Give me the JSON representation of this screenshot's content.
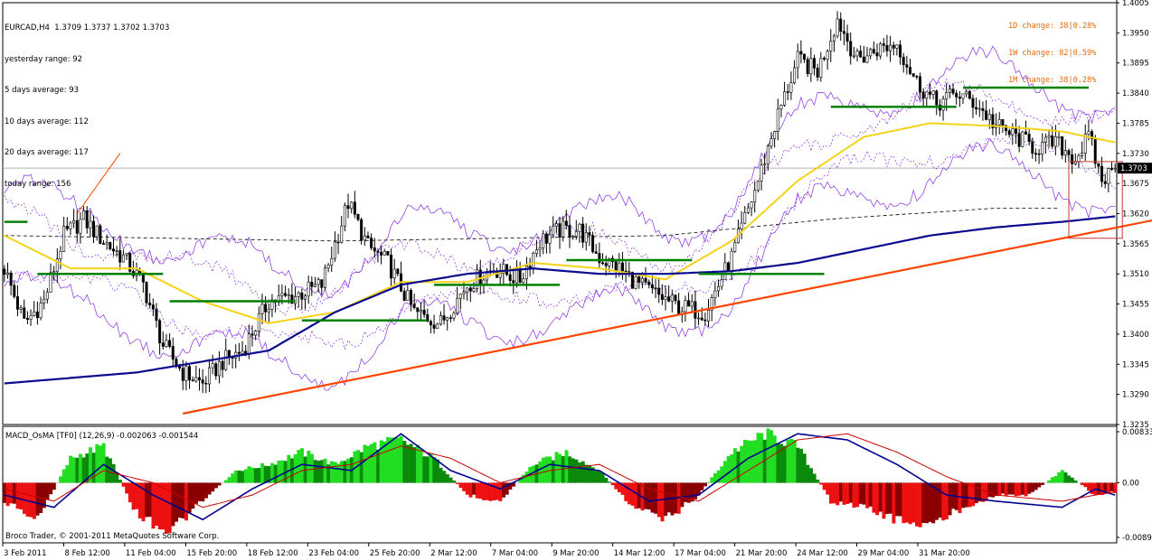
{
  "header": {
    "symbol_line": "EURCAD,H4  1.3709 1.3737 1.3702 1.3703",
    "stats": [
      "yesterday range: 92",
      "5 days average: 93",
      "10 days average: 112",
      "20 days average: 117",
      "today range: 156"
    ]
  },
  "changes": [
    "1D change: 38|0.28%",
    "1W change: 82|0.59%",
    "1M change: 38|0.28%"
  ],
  "current_price_label": "1.3703",
  "macd": {
    "title": "MACD_OsMA [TF0] (12,26,9) -0.002063 -0.001544",
    "axis_labels": [
      "0.00833",
      "0.00",
      "-0.00891"
    ]
  },
  "copyright": "Broco Trader, © 2001-2011 MetaQuotes Software Corp.",
  "colors": {
    "bull_candle": "#000000",
    "bear_candle": "#000000",
    "ma_yellow": "#f5d21a",
    "ma_blue": "#0a0a8f",
    "bands": "#8a2be2",
    "trendline": "#ff4500",
    "pivot_lines": "#008000",
    "hist_pos": "#00cc00",
    "hist_neg": "#dd0000",
    "macd_line": "#000090",
    "signal_line": "#cc0000"
  },
  "chart_data": [
    {
      "type": "candlestick",
      "title": "EURCAD,H4",
      "y_axis_labels": [
        "1.4005",
        "1.3950",
        "1.3895",
        "1.3840",
        "1.3785",
        "1.3730",
        "1.3675",
        "1.3620",
        "1.3565",
        "1.3510",
        "1.3455",
        "1.3400",
        "1.3345",
        "1.3290",
        "1.3235"
      ],
      "ylim": [
        1.3235,
        1.4005
      ],
      "x_axis_labels": [
        "3 Feb 2011",
        "8 Feb 12:00",
        "11 Feb 04:00",
        "15 Feb 20:00",
        "18 Feb 12:00",
        "23 Feb 04:00",
        "25 Feb 20:00",
        "2 Mar 12:00",
        "7 Mar 04:00",
        "9 Mar 20:00",
        "14 Mar 12:00",
        "17 Mar 04:00",
        "21 Mar 20:00",
        "24 Mar 12:00",
        "29 Mar 04:00",
        "31 Mar 20:00"
      ],
      "current_price": 1.3703,
      "close_path": [
        [
          0,
          1.352
        ],
        [
          6,
          1.342
        ],
        [
          12,
          1.346
        ],
        [
          18,
          1.358
        ],
        [
          24,
          1.361
        ],
        [
          30,
          1.357
        ],
        [
          36,
          1.354
        ],
        [
          42,
          1.349
        ],
        [
          48,
          1.338
        ],
        [
          54,
          1.333
        ],
        [
          60,
          1.331
        ],
        [
          66,
          1.335
        ],
        [
          72,
          1.337
        ],
        [
          80,
          1.346
        ],
        [
          88,
          1.347
        ],
        [
          96,
          1.349
        ],
        [
          104,
          1.364
        ],
        [
          110,
          1.356
        ],
        [
          116,
          1.353
        ],
        [
          124,
          1.344
        ],
        [
          132,
          1.342
        ],
        [
          140,
          1.349
        ],
        [
          148,
          1.352
        ],
        [
          156,
          1.35
        ],
        [
          162,
          1.357
        ],
        [
          168,
          1.359
        ],
        [
          174,
          1.359
        ],
        [
          180,
          1.354
        ],
        [
          186,
          1.352
        ],
        [
          192,
          1.349
        ],
        [
          198,
          1.347
        ],
        [
          204,
          1.345
        ],
        [
          212,
          1.344
        ],
        [
          220,
          1.354
        ],
        [
          228,
          1.368
        ],
        [
          234,
          1.38
        ],
        [
          240,
          1.39
        ],
        [
          246,
          1.388
        ],
        [
          252,
          1.3975
        ],
        [
          258,
          1.39
        ],
        [
          264,
          1.392
        ],
        [
          270,
          1.393
        ],
        [
          276,
          1.386
        ],
        [
          282,
          1.382
        ],
        [
          288,
          1.384
        ],
        [
          294,
          1.382
        ],
        [
          300,
          1.378
        ],
        [
          306,
          1.376
        ],
        [
          312,
          1.374
        ],
        [
          318,
          1.375
        ],
        [
          324,
          1.372
        ],
        [
          328,
          1.376
        ],
        [
          332,
          1.368
        ],
        [
          336,
          1.3703
        ]
      ],
      "yellow_ma": [
        [
          0,
          1.358
        ],
        [
          20,
          1.352
        ],
        [
          40,
          1.352
        ],
        [
          60,
          1.346
        ],
        [
          80,
          1.342
        ],
        [
          100,
          1.344
        ],
        [
          120,
          1.3495
        ],
        [
          140,
          1.3495
        ],
        [
          160,
          1.353
        ],
        [
          180,
          1.352
        ],
        [
          200,
          1.35
        ],
        [
          220,
          1.357
        ],
        [
          240,
          1.368
        ],
        [
          260,
          1.376
        ],
        [
          280,
          1.3785
        ],
        [
          300,
          1.378
        ],
        [
          320,
          1.377
        ],
        [
          336,
          1.375
        ]
      ],
      "blue_ma": [
        [
          0,
          1.331
        ],
        [
          40,
          1.333
        ],
        [
          80,
          1.337
        ],
        [
          100,
          1.344
        ],
        [
          120,
          1.349
        ],
        [
          140,
          1.351
        ],
        [
          160,
          1.352
        ],
        [
          180,
          1.351
        ],
        [
          200,
          1.351
        ],
        [
          220,
          1.3515
        ],
        [
          240,
          1.353
        ],
        [
          260,
          1.3555
        ],
        [
          280,
          1.358
        ],
        [
          300,
          1.3595
        ],
        [
          320,
          1.3605
        ],
        [
          336,
          1.3615
        ]
      ],
      "trendline": [
        [
          54,
          1.3255
        ],
        [
          395,
          1.3665
        ]
      ],
      "pivot_segments": [
        [
          0,
          7,
          1.3605
        ],
        [
          10,
          48,
          1.351
        ],
        [
          50,
          88,
          1.346
        ],
        [
          90,
          128,
          1.3425
        ],
        [
          130,
          168,
          1.349
        ],
        [
          170,
          208,
          1.3535
        ],
        [
          210,
          248,
          1.351
        ],
        [
          250,
          288,
          1.3815
        ],
        [
          290,
          328,
          1.385
        ]
      ],
      "dashed_ma": [
        [
          0,
          1.358
        ],
        [
          100,
          1.357
        ],
        [
          200,
          1.358
        ],
        [
          250,
          1.361
        ],
        [
          300,
          1.363
        ],
        [
          320,
          1.363
        ]
      ]
    },
    {
      "type": "bar",
      "title": "MACD_OsMA [TF0] (12,26,9)",
      "ylim": [
        -0.00891,
        0.00833
      ],
      "current_values": [
        -0.002063,
        -0.001544
      ],
      "hist_path": [
        [
          0,
          -0.003
        ],
        [
          10,
          -0.006
        ],
        [
          20,
          0.004
        ],
        [
          30,
          0.006
        ],
        [
          40,
          -0.005
        ],
        [
          50,
          -0.008
        ],
        [
          60,
          -0.003
        ],
        [
          70,
          0.002
        ],
        [
          80,
          0.003
        ],
        [
          90,
          0.005
        ],
        [
          100,
          0.003
        ],
        [
          110,
          0.006
        ],
        [
          120,
          0.007
        ],
        [
          130,
          0.004
        ],
        [
          140,
          -0.002
        ],
        [
          150,
          -0.003
        ],
        [
          160,
          0.003
        ],
        [
          170,
          0.005
        ],
        [
          180,
          0.002
        ],
        [
          190,
          -0.004
        ],
        [
          200,
          -0.006
        ],
        [
          210,
          -0.002
        ],
        [
          220,
          0.005
        ],
        [
          230,
          0.008
        ],
        [
          240,
          0.006
        ],
        [
          250,
          -0.003
        ],
        [
          260,
          -0.004
        ],
        [
          270,
          -0.006
        ],
        [
          280,
          -0.007
        ],
        [
          290,
          -0.004
        ],
        [
          300,
          -0.002
        ],
        [
          310,
          -0.002
        ],
        [
          320,
          0.002
        ],
        [
          330,
          -0.002
        ],
        [
          336,
          -0.0015
        ]
      ],
      "macd_line": [
        [
          0,
          -0.002
        ],
        [
          15,
          -0.004
        ],
        [
          30,
          0.003
        ],
        [
          45,
          -0.002
        ],
        [
          60,
          -0.006
        ],
        [
          75,
          -0.001
        ],
        [
          90,
          0.003
        ],
        [
          105,
          0.002
        ],
        [
          120,
          0.008
        ],
        [
          135,
          0.002
        ],
        [
          150,
          -0.001
        ],
        [
          165,
          0.003
        ],
        [
          180,
          0.002
        ],
        [
          195,
          -0.003
        ],
        [
          210,
          -0.002
        ],
        [
          225,
          0.004
        ],
        [
          240,
          0.008
        ],
        [
          255,
          0.007
        ],
        [
          270,
          0.003
        ],
        [
          285,
          -0.002
        ],
        [
          300,
          -0.003
        ],
        [
          320,
          -0.004
        ],
        [
          330,
          -0.001
        ],
        [
          336,
          -0.002
        ]
      ],
      "signal_line": [
        [
          0,
          -0.001
        ],
        [
          15,
          -0.003
        ],
        [
          30,
          0.002
        ],
        [
          45,
          0.0
        ],
        [
          60,
          -0.004
        ],
        [
          75,
          -0.002
        ],
        [
          90,
          0.002
        ],
        [
          105,
          0.003
        ],
        [
          120,
          0.006
        ],
        [
          135,
          0.004
        ],
        [
          150,
          0.0
        ],
        [
          165,
          0.002
        ],
        [
          180,
          0.003
        ],
        [
          195,
          -0.001
        ],
        [
          210,
          -0.003
        ],
        [
          225,
          0.002
        ],
        [
          240,
          0.007
        ],
        [
          255,
          0.008
        ],
        [
          270,
          0.005
        ],
        [
          285,
          0.001
        ],
        [
          300,
          -0.002
        ],
        [
          320,
          -0.003
        ],
        [
          330,
          -0.002
        ],
        [
          336,
          -0.0015
        ]
      ]
    }
  ]
}
